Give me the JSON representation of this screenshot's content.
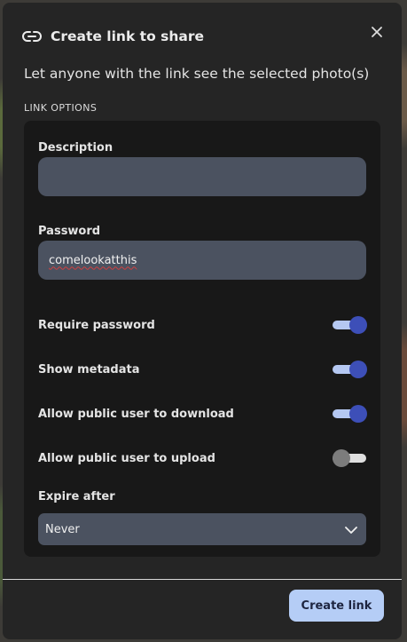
{
  "dialog": {
    "title": "Create link to share",
    "subtitle": "Let anyone with the link see the selected photo(s)",
    "section_label": "LINK OPTIONS"
  },
  "description": {
    "label": "Description",
    "value": ""
  },
  "password": {
    "label": "Password",
    "value": "comelookatthis"
  },
  "toggles": [
    {
      "label": "Require password",
      "on": true
    },
    {
      "label": "Show metadata",
      "on": true
    },
    {
      "label": "Allow public user to download",
      "on": true
    },
    {
      "label": "Allow public user to upload",
      "on": false
    }
  ],
  "expire": {
    "label": "Expire after",
    "value": "Never"
  },
  "footer": {
    "create_label": "Create link"
  },
  "colors": {
    "accent": "#3d4fb8",
    "accent_light": "#b5cdf6",
    "dialog_bg": "#252525",
    "panel_bg": "#181818"
  }
}
